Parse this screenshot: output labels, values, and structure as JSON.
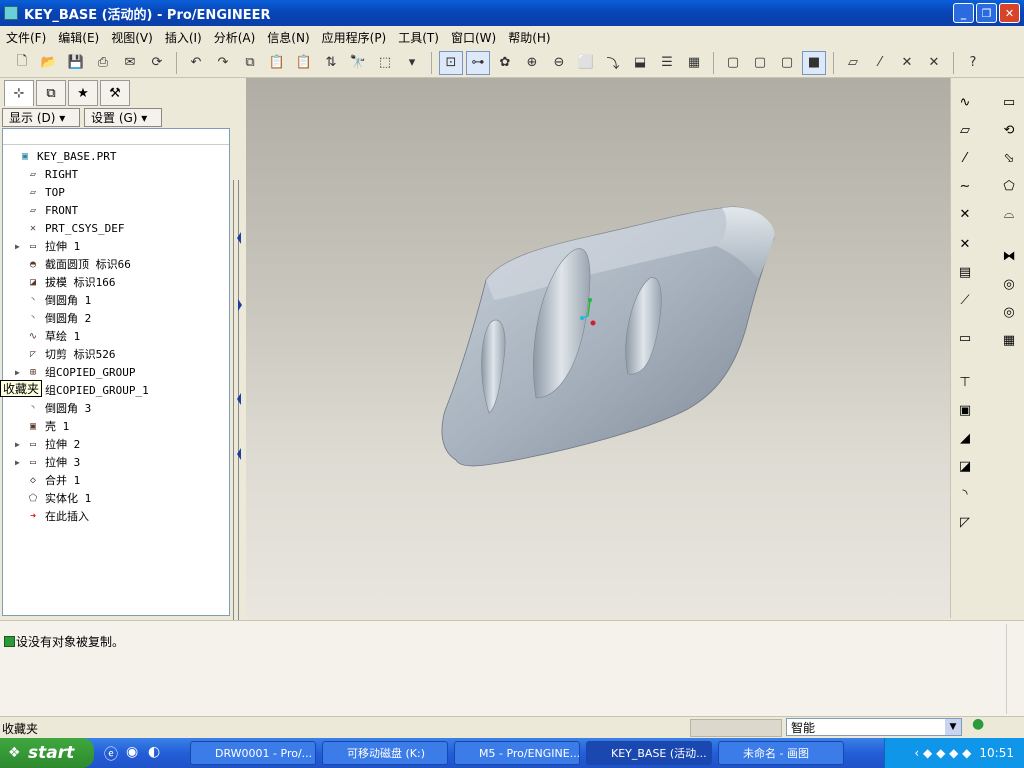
{
  "window": {
    "title": "KEY_BASE (活动的) - Pro/ENGINEER"
  },
  "menu": [
    "文件(F)",
    "编辑(E)",
    "视图(V)",
    "插入(I)",
    "分析(A)",
    "信息(N)",
    "应用程序(P)",
    "工具(T)",
    "窗口(W)",
    "帮助(H)"
  ],
  "navigator": {
    "show_label": "显示 (D) ▾",
    "settings_label": "设置 (G) ▾",
    "tooltip": "收藏夹",
    "tree": [
      {
        "label": "KEY_BASE.PRT",
        "icon": "part-icon",
        "expandable": false,
        "indent": 0
      },
      {
        "label": "RIGHT",
        "icon": "datum-plane-icon",
        "expandable": false,
        "indent": 1
      },
      {
        "label": "TOP",
        "icon": "datum-plane-icon",
        "expandable": false,
        "indent": 1
      },
      {
        "label": "FRONT",
        "icon": "datum-plane-icon",
        "expandable": false,
        "indent": 1
      },
      {
        "label": "PRT_CSYS_DEF",
        "icon": "csys-icon",
        "expandable": false,
        "indent": 1
      },
      {
        "label": "拉伸 1",
        "icon": "extrude-icon",
        "expandable": true,
        "indent": 1
      },
      {
        "label": "截面圆顶 标识66",
        "icon": "dome-icon",
        "expandable": false,
        "indent": 1
      },
      {
        "label": "拔模 标识166",
        "icon": "draft-icon",
        "expandable": false,
        "indent": 1
      },
      {
        "label": "倒圆角 1",
        "icon": "round-icon",
        "expandable": false,
        "indent": 1
      },
      {
        "label": "倒圆角 2",
        "icon": "round-icon",
        "expandable": false,
        "indent": 1
      },
      {
        "label": "草绘 1",
        "icon": "sketch-icon",
        "expandable": false,
        "indent": 1
      },
      {
        "label": "切剪 标识526",
        "icon": "cut-icon",
        "expandable": false,
        "indent": 1
      },
      {
        "label": "组COPIED_GROUP",
        "icon": "group-icon",
        "expandable": true,
        "indent": 1
      },
      {
        "label": "组COPIED_GROUP_1",
        "icon": "group-icon",
        "expandable": true,
        "indent": 1
      },
      {
        "label": "倒圆角 3",
        "icon": "round-icon",
        "expandable": false,
        "indent": 1
      },
      {
        "label": "壳 1",
        "icon": "shell-icon",
        "expandable": false,
        "indent": 1
      },
      {
        "label": "拉伸 2",
        "icon": "extrude-icon",
        "expandable": true,
        "indent": 1
      },
      {
        "label": "拉伸 3",
        "icon": "extrude-icon",
        "expandable": true,
        "indent": 1
      },
      {
        "label": "合并 1",
        "icon": "merge-icon",
        "expandable": false,
        "indent": 1
      },
      {
        "label": "实体化 1",
        "icon": "solidify-icon",
        "expandable": false,
        "indent": 1
      },
      {
        "label": "在此插入",
        "icon": "insert-here-arrow-icon",
        "expandable": false,
        "indent": 1
      }
    ]
  },
  "message": "设没有对象被复制。",
  "status": {
    "left": "收藏夹",
    "filter": "智能"
  },
  "taskbar": {
    "start": "start",
    "tasks": [
      "DRW0001 - Pro/...",
      "可移动磁盘 (K:)",
      "M5 - Pro/ENGINE...",
      "KEY_BASE (活动...",
      "未命名 - 画图"
    ],
    "clock": "10:51"
  }
}
